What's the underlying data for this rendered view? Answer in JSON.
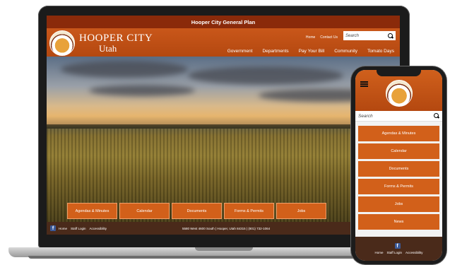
{
  "site": {
    "topbar_title": "Hooper City General Plan",
    "brand_name": "HOOPER CITY",
    "brand_state": "Utah",
    "utility_links": [
      "Home",
      "Contact Us"
    ],
    "search_placeholder": "Search",
    "nav": [
      "Government",
      "Departments",
      "Pay Your Bill",
      "Community",
      "Tomato Days"
    ],
    "quick_links": [
      "Agendas & Minutes",
      "Calendar",
      "Documents",
      "Forms & Permits",
      "Jobs"
    ],
    "footer_links": [
      "Home",
      "Staff Login",
      "Accessibility"
    ],
    "footer_address": "5580 West 4600 South | Hooper, Utah 84315 | (801) 732-1064",
    "brand_color": "#c9571a",
    "topbar_color": "#8a2a0a",
    "footer_color": "#4a2a1a"
  },
  "phone": {
    "search_placeholder": "Search",
    "buttons": [
      "Agendas & Minutes",
      "Calendar",
      "Documents",
      "Forms & Permits",
      "Jobs",
      "News"
    ],
    "footer_links": [
      "Home",
      "Staff Login",
      "Accessibility"
    ]
  },
  "icons": {
    "search": "magnifier-icon",
    "social": "facebook-icon",
    "menu": "hamburger-icon"
  }
}
